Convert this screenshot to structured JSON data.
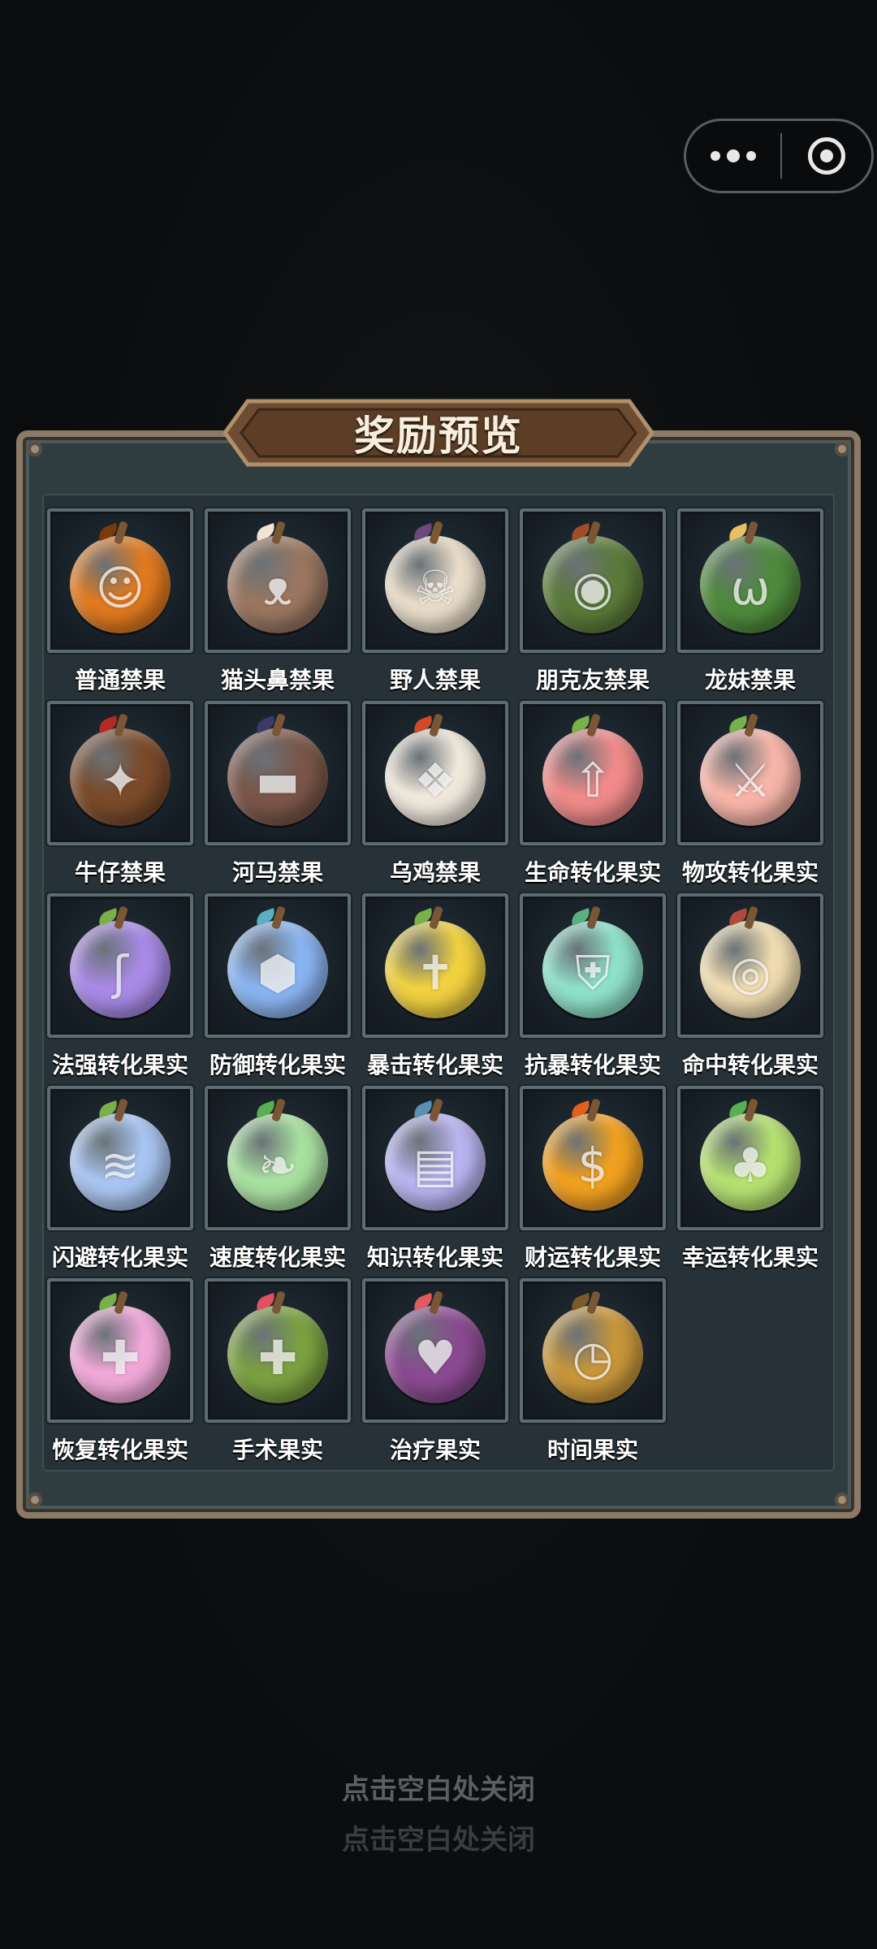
{
  "capsule": {
    "more_icon": "more-dots-icon",
    "close_icon": "target-close-icon"
  },
  "modal": {
    "title": "奖励预览",
    "items": [
      {
        "name": "普通禁果",
        "icon": "pumpkin",
        "color": "#e07a1f",
        "accent": "#7a3a0c",
        "glyph": "☺"
      },
      {
        "name": "猫头鼻禁果",
        "icon": "cat",
        "color": "#9a7660",
        "accent": "#f1e3d6",
        "glyph": "ᴥ"
      },
      {
        "name": "野人禁果",
        "icon": "skull",
        "color": "#e8dcc8",
        "accent": "#6a4a7a",
        "glyph": "☠"
      },
      {
        "name": "朋克友禁果",
        "icon": "punk",
        "color": "#5b7a3a",
        "accent": "#a04d2a",
        "glyph": "◉"
      },
      {
        "name": "龙妹禁果",
        "icon": "dragon",
        "color": "#4e8a3c",
        "accent": "#e8c060",
        "glyph": "ω"
      },
      {
        "name": "牛仔禁果",
        "icon": "cowboy",
        "color": "#7a4a2a",
        "accent": "#b22a22",
        "glyph": "✦"
      },
      {
        "name": "河马禁果",
        "icon": "hippo",
        "color": "#7a5548",
        "accent": "#3a3a6a",
        "glyph": "▬"
      },
      {
        "name": "乌鸡禁果",
        "icon": "chicken",
        "color": "#efe8dc",
        "accent": "#d04a2a",
        "glyph": "❖"
      },
      {
        "name": "生命转化果实",
        "icon": "life-arrow",
        "color": "#f08a8a",
        "accent": "#7ab04a",
        "glyph": "⇧"
      },
      {
        "name": "物攻转化果实",
        "icon": "sword",
        "color": "#f7b4a8",
        "accent": "#7ab04a",
        "glyph": "⚔"
      },
      {
        "name": "法强转化果实",
        "icon": "magic-swirl",
        "color": "#a88ae6",
        "accent": "#7ab04a",
        "glyph": "ʃ"
      },
      {
        "name": "防御转化果实",
        "icon": "defense",
        "color": "#8ab4f0",
        "accent": "#5ab0c0",
        "glyph": "⬢"
      },
      {
        "name": "暴击转化果实",
        "icon": "crit",
        "color": "#f0d040",
        "accent": "#7ab04a",
        "glyph": "✝"
      },
      {
        "name": "抗暴转化果实",
        "icon": "shield",
        "color": "#8ee0c8",
        "accent": "#5ab080",
        "glyph": "⛨"
      },
      {
        "name": "命中转化果实",
        "icon": "target",
        "color": "#f0dcb0",
        "accent": "#b04a3a",
        "glyph": "◎"
      },
      {
        "name": "闪避转化果实",
        "icon": "dodge",
        "color": "#a8c4f0",
        "accent": "#7ab04a",
        "glyph": "≋"
      },
      {
        "name": "速度转化果实",
        "icon": "speed",
        "color": "#a8e0a0",
        "accent": "#5ab050",
        "glyph": "❧"
      },
      {
        "name": "知识转化果实",
        "icon": "book",
        "color": "#b8b4f0",
        "accent": "#5a90b0",
        "glyph": "▤"
      },
      {
        "name": "财运转化果实",
        "icon": "money",
        "color": "#f0a020",
        "accent": "#e06020",
        "glyph": "$"
      },
      {
        "name": "幸运转化果实",
        "icon": "clover",
        "color": "#b4e070",
        "accent": "#5ab050",
        "glyph": "♣"
      },
      {
        "name": "恢复转化果实",
        "icon": "heal-cross",
        "color": "#f0a8d8",
        "accent": "#7ab04a",
        "glyph": "✚"
      },
      {
        "name": "手术果实",
        "icon": "surgery",
        "color": "#7aa040",
        "accent": "#e05060",
        "glyph": "✚"
      },
      {
        "name": "治疗果实",
        "icon": "heart",
        "color": "#8a4a90",
        "accent": "#e05a60",
        "glyph": "♥"
      },
      {
        "name": "时间果实",
        "icon": "clock",
        "color": "#c8963a",
        "accent": "#7a5a2a",
        "glyph": "◷"
      }
    ]
  },
  "hints": {
    "close_primary": "点击空白处关闭",
    "close_secondary": "点击空白处关闭"
  }
}
